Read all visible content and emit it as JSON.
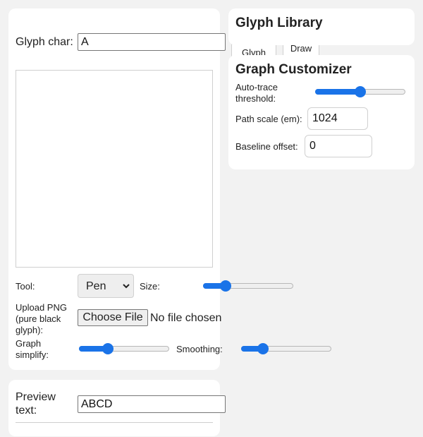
{
  "editor": {
    "glyph_char_label": "Glyph char:",
    "glyph_char_value": "A",
    "tool_label": "Tool:",
    "tool_value": "Pen",
    "size_label": "Size:",
    "size_value": 0.25,
    "upload_label": "Upload PNG (pure black glyph):",
    "choose_file_label": "Choose File",
    "no_file_label": "No file chosen",
    "graph_simplify_label": "Graph simplify:",
    "graph_simplify_value": 0.32,
    "smoothing_label": "Smoothing:",
    "smoothing_value": 0.24
  },
  "library": {
    "title": "Glyph Library",
    "tabs": [
      {
        "label": "Glyph"
      },
      {
        "label": "Draw"
      }
    ]
  },
  "customizer": {
    "title": "Graph Customizer",
    "auto_trace_label": "Auto-trace threshold:",
    "auto_trace_value": 0.5,
    "path_scale_label": "Path scale (em):",
    "path_scale_value": "1024",
    "baseline_label": "Baseline offset:",
    "baseline_value": "0"
  },
  "preview": {
    "label": "Preview text:",
    "value": "ABCD"
  },
  "colors": {
    "accent": "#1a73e8",
    "background": "#f2f2f2",
    "card": "#ffffff"
  }
}
